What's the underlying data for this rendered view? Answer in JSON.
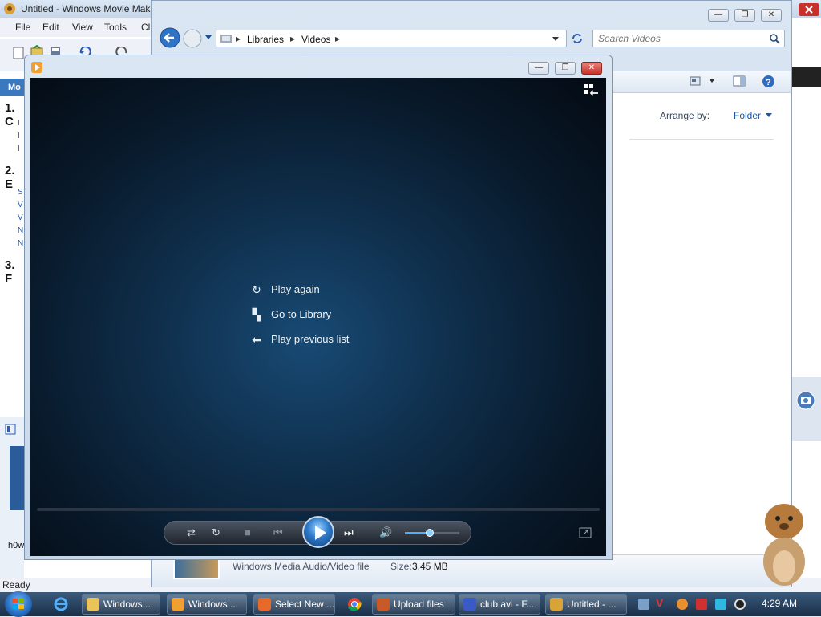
{
  "movie_maker": {
    "title": "Untitled - Windows Movie Mak",
    "menu": [
      "File",
      "Edit",
      "View",
      "Tools",
      "Cli"
    ],
    "tasks_header": "Mo",
    "sections": [
      "1. C",
      "2. E",
      "3. F"
    ],
    "status": "Ready",
    "thumb_caption": "h0w"
  },
  "explorer": {
    "breadcrumb": [
      "Libraries",
      "Videos"
    ],
    "search_placeholder": "Search Videos",
    "arrange_label": "Arrange by:",
    "arrange_value": "Folder",
    "details_type": "Windows Media Audio/Video file",
    "details_size_label": "Size:",
    "details_size_value": "3.45 MB"
  },
  "media_player": {
    "menu": {
      "play_again": "Play again",
      "go_to_library": "Go to Library",
      "play_previous_list": "Play previous list"
    },
    "volume_level": 0.45
  },
  "taskbar": {
    "items": [
      {
        "label": "Windows ...",
        "icon": "folder-icon",
        "color": "#e8c45a"
      },
      {
        "label": "Windows ...",
        "icon": "media-player-icon",
        "color": "#f0a030"
      },
      {
        "label": "Select New ...",
        "icon": "firefox-icon",
        "color": "#e86a2a"
      },
      {
        "label": "Upload files",
        "icon": "upload-icon",
        "color": "#c85a2a"
      },
      {
        "label": "club.avi - F...",
        "icon": "video-file-icon",
        "color": "#3a5ac8"
      },
      {
        "label": "Untitled - ...",
        "icon": "movie-maker-icon",
        "color": "#d8a43a"
      }
    ],
    "clock": "4:29 AM"
  }
}
